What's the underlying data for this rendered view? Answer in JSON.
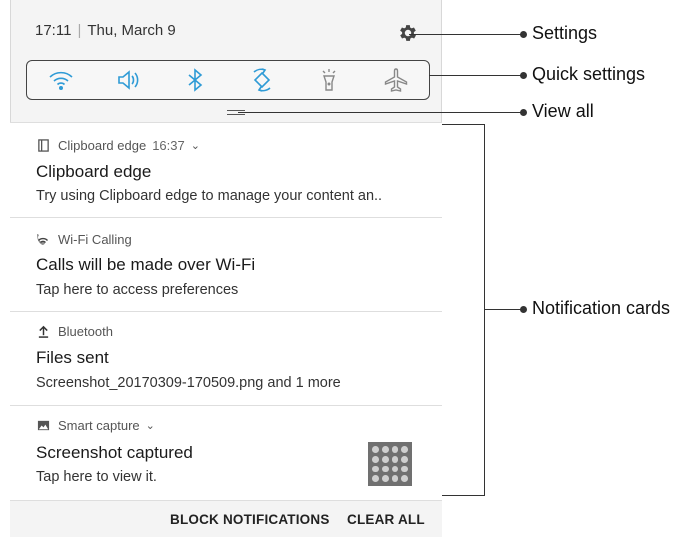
{
  "status": {
    "time": "17:11",
    "separator": "|",
    "date": "Thu, March 9"
  },
  "quick_settings": {
    "icons": [
      "wifi-icon",
      "sound-icon",
      "bluetooth-icon",
      "auto-rotate-icon",
      "flashlight-icon",
      "airplane-mode-icon"
    ],
    "accent": "#2f9bd6"
  },
  "notifications": [
    {
      "app": "Clipboard edge",
      "time": "16:37",
      "title": "Clipboard edge",
      "body": "Try using Clipboard edge to manage your content an.."
    },
    {
      "app": "Wi-Fi Calling",
      "title": "Calls will be made over Wi-Fi",
      "body": "Tap here to access preferences"
    },
    {
      "app": "Bluetooth",
      "title": "Files sent",
      "body": "Screenshot_20170309-170509.png and 1 more"
    },
    {
      "app": "Smart capture",
      "title": "Screenshot captured",
      "body": "Tap here to view it."
    }
  ],
  "footer": {
    "block_label": "BLOCK NOTIFICATIONS",
    "clear_label": "CLEAR ALL"
  },
  "callouts": {
    "settings": "Settings",
    "quick_settings": "Quick settings",
    "view_all": "View all",
    "notification_cards": "Notification cards"
  }
}
